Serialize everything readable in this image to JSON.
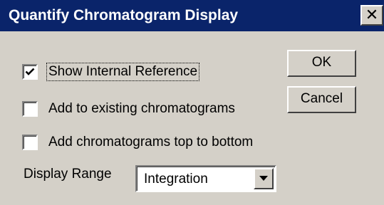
{
  "window": {
    "title": "Quantify Chromatogram Display",
    "close_glyph": "✕"
  },
  "options": [
    {
      "label": "Show Internal Reference",
      "checked": true,
      "focused": true
    },
    {
      "label": "Add to existing chromatograms",
      "checked": false,
      "focused": false
    },
    {
      "label": "Add chromatograms top to bottom",
      "checked": false,
      "focused": false
    }
  ],
  "buttons": {
    "ok_label": "OK",
    "cancel_label": "Cancel"
  },
  "display_range": {
    "label": "Display Range",
    "selected": "Integration"
  },
  "colors": {
    "title_bar": "#0a246a",
    "face": "#d4d0c8"
  }
}
